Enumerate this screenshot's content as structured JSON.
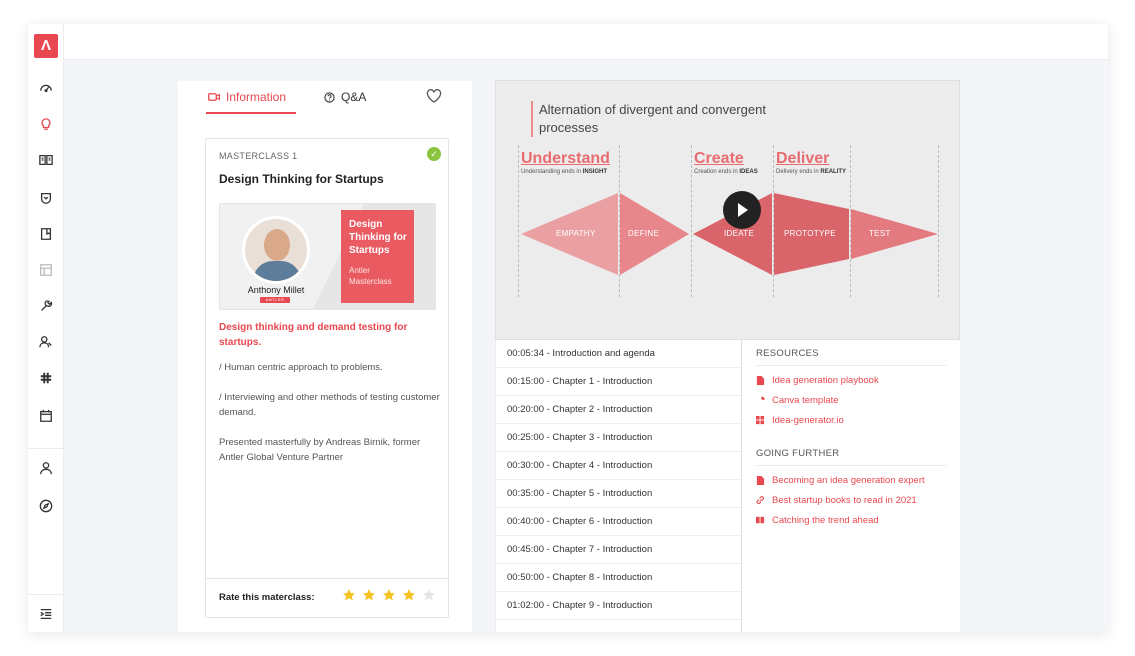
{
  "app": {
    "logo_letter": "Λ"
  },
  "sidebar": {
    "items": [
      {
        "name": "dashboard-icon"
      },
      {
        "name": "lightbulb-icon",
        "active": true
      },
      {
        "name": "book-open-icon"
      },
      {
        "name": "shield-icon"
      },
      {
        "name": "notebook-icon"
      },
      {
        "name": "layout-icon",
        "muted": true
      },
      {
        "name": "wrench-icon"
      },
      {
        "name": "users-icon"
      },
      {
        "name": "slack-icon"
      },
      {
        "name": "calendar-icon"
      },
      {
        "name": "user-icon"
      },
      {
        "name": "compass-icon"
      },
      {
        "name": "menu-collapse-icon"
      }
    ]
  },
  "tabs": {
    "information": "Information",
    "qa": "Q&A"
  },
  "card": {
    "eyebrow": "MASTERCLASS 1",
    "title": "Design Thinking for Startups",
    "presenter": "Anthony Millet",
    "brand": "ANTLER",
    "book_title": "Design Thinking for Startups",
    "book_sub": "Antler Masterclass",
    "headline": "Design thinking and demand testing for startups.",
    "p1": "/ Human centric approach to problems.",
    "p2": "/ Interviewing and other methods of testing customer demand.",
    "p3": "Presented masterfully by Andreas Birnik, former Antler Global Venture Partner",
    "rate_label": "Rate this materclass:",
    "rating": 4,
    "rating_max": 5
  },
  "video": {
    "title": "Alternation of divergent and convergent processes",
    "phases": [
      {
        "title": "Understand",
        "sub_pre": "Understanding ends in ",
        "sub_bold": "INSIGHT"
      },
      {
        "title": "Create",
        "sub_pre": "Creation ends in ",
        "sub_bold": "IDEAS"
      },
      {
        "title": "Deliver",
        "sub_pre": "Delivery ends in ",
        "sub_bold": "REALITY"
      }
    ],
    "stages": [
      "EMPATHY",
      "DEFINE",
      "IDEATE",
      "PROTOTYPE",
      "TEST"
    ],
    "colors": {
      "light": "#eaa0a2",
      "mid": "#e7878b",
      "dark": "#d9646a"
    }
  },
  "chapters": [
    "00:05:34 - Introduction and agenda",
    "00:15:00 - Chapter 1 - Introduction",
    "00:20:00 - Chapter 2 - Introduction",
    "00:25:00 - Chapter 3 - Introduction",
    "00:30:00 - Chapter 4 - Introduction",
    "00:35:00 - Chapter 5 - Introduction",
    "00:40:00 - Chapter 6 - Introduction",
    "00:45:00 - Chapter 7 - Introduction",
    "00:50:00 - Chapter 8 - Introduction",
    "01:02:00 - Chapter 9 - Introduction"
  ],
  "resources": {
    "heading": "RESOURCES",
    "items": [
      {
        "icon": "pdf-icon",
        "label": "Idea generation playbook"
      },
      {
        "icon": "wrench-icon",
        "label": "Canva template"
      },
      {
        "icon": "grid-icon",
        "label": "Idea-generator.io"
      }
    ]
  },
  "going_further": {
    "heading": "GOING FURTHER",
    "items": [
      {
        "icon": "pdf-icon",
        "label": "Becoming an idea generation expert"
      },
      {
        "icon": "link-icon",
        "label": "Best startup books to read in 2021"
      },
      {
        "icon": "video-icon",
        "label": "Catching the trend ahead"
      }
    ]
  },
  "theme": {
    "accent": "#e8484f",
    "check": "#8bc53f",
    "star": "#f6c325"
  }
}
